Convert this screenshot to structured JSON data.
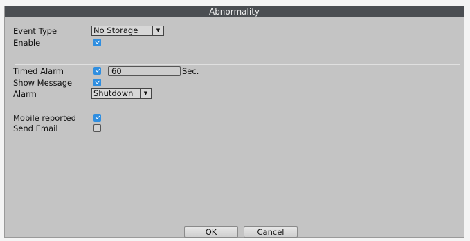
{
  "title": "Abnormality",
  "event_type": {
    "label": "Event Type",
    "value": "No Storage"
  },
  "enable": {
    "label": "Enable",
    "checked": true
  },
  "timed_alarm": {
    "label": "Timed Alarm",
    "checked": true,
    "value": "60",
    "unit": "Sec."
  },
  "show_message": {
    "label": "Show Message",
    "checked": true
  },
  "alarm": {
    "label": "Alarm",
    "value": "Shutdown"
  },
  "mobile_reported": {
    "label": "Mobile reported",
    "checked": true
  },
  "send_email": {
    "label": "Send Email",
    "checked": false
  },
  "buttons": {
    "ok": "OK",
    "cancel": "Cancel"
  },
  "icons": {
    "dropdown": "▼"
  },
  "colors": {
    "accent": "#2f8ee0",
    "titlebar": "#4b4e52",
    "panel": "#c4c4c4"
  }
}
